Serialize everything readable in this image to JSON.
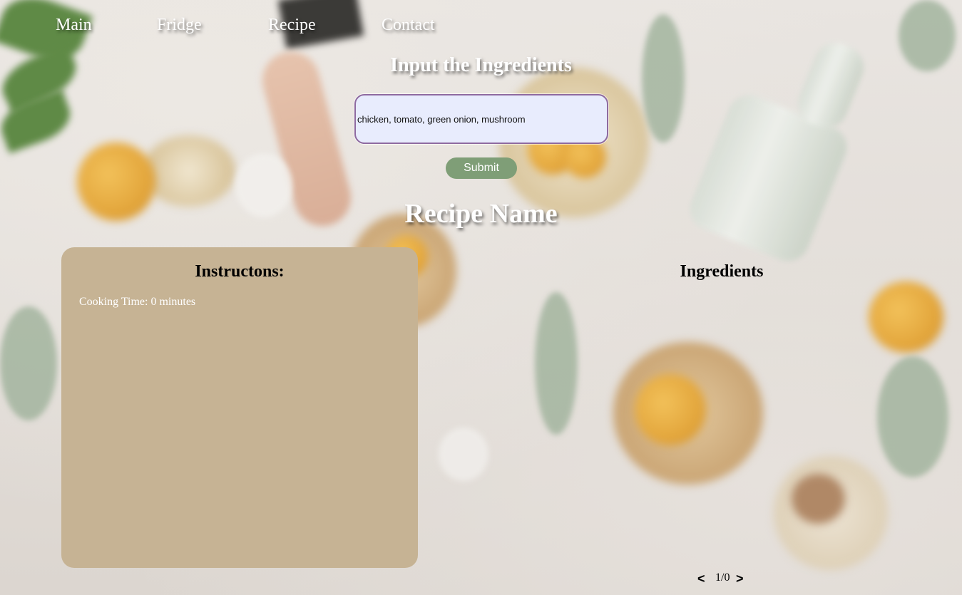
{
  "nav": {
    "items": [
      {
        "label": "Main"
      },
      {
        "label": "Fridge"
      },
      {
        "label": "Recipe"
      },
      {
        "label": "Contact"
      }
    ]
  },
  "input_section": {
    "heading": "Input the Ingredients",
    "ingredients_value": "chicken, tomato, green onion, mushroom",
    "submit_label": "Submit"
  },
  "recipe": {
    "name": "Recipe Name",
    "instructions_heading": "Instructons:",
    "cooking_time": "Cooking Time: 0 minutes",
    "ingredients_heading": "Ingredients"
  },
  "pager": {
    "prev": "<",
    "count": "1/0",
    "next": ">"
  },
  "colors": {
    "panel": "#c6b394",
    "submit": "#7f9e77",
    "input_bg": "#e8ecfd",
    "input_border": "#8e6aa0"
  }
}
